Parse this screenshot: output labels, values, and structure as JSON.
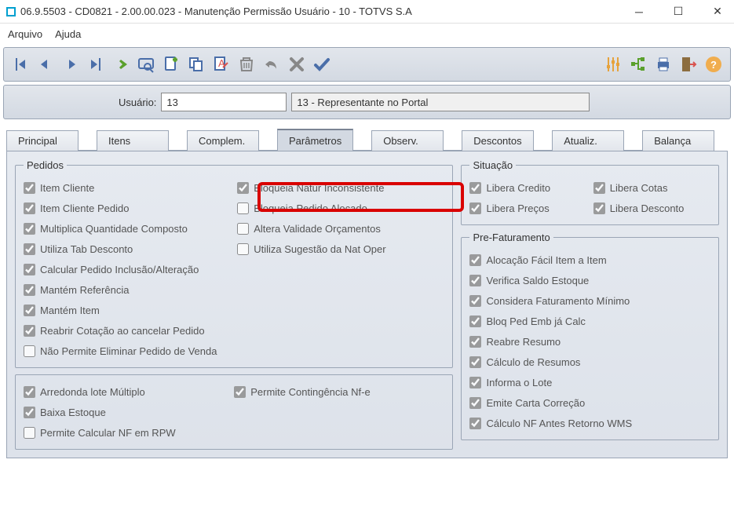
{
  "window": {
    "title": "06.9.5503 - CD0821 - 2.00.00.023 - Manutenção Permissão Usuário - 10 - TOTVS S.A"
  },
  "menu": {
    "arquivo": "Arquivo",
    "ajuda": "Ajuda"
  },
  "header": {
    "usuario_label": "Usuário:",
    "usuario_code": "13",
    "usuario_desc": "13 - Representante no Portal"
  },
  "tabs": {
    "principal": "Principal",
    "itens": "Itens",
    "complem": "Complem.",
    "parametros": "Parâmetros",
    "observ": "Observ.",
    "descontos": "Descontos",
    "atualiz": "Atualiz.",
    "balanca": "Balança"
  },
  "groups": {
    "pedidos": "Pedidos",
    "situacao": "Situação",
    "prefat": "Pre-Faturamento"
  },
  "pedidos": {
    "col1": [
      {
        "label": "Item Cliente",
        "checked": true
      },
      {
        "label": "Item Cliente Pedido",
        "checked": true
      },
      {
        "label": "Multiplica Quantidade Composto",
        "checked": true
      },
      {
        "label": "Utiliza Tab Desconto",
        "checked": true
      },
      {
        "label": "Calcular Pedido Inclusão/Alteração",
        "checked": true
      },
      {
        "label": "Mantém Referência",
        "checked": true
      },
      {
        "label": "Mantém Item",
        "checked": true
      },
      {
        "label": "Reabrir Cotação ao cancelar Pedido",
        "checked": true
      },
      {
        "label": "Não Permite Eliminar Pedido de Venda",
        "checked": false
      }
    ],
    "col2": [
      {
        "label": "Bloqueia Natur Inconsistente",
        "checked": true
      },
      {
        "label": "Bloqueia Pedido Alocado",
        "checked": false
      },
      {
        "label": "Altera Validade Orçamentos",
        "checked": false
      },
      {
        "label": "Utiliza Sugestão da Nat Oper",
        "checked": false
      }
    ]
  },
  "pedidos_bottom": {
    "col1": [
      {
        "label": "Arredonda lote Múltiplo",
        "checked": true
      },
      {
        "label": "Baixa Estoque",
        "checked": true
      },
      {
        "label": "Permite Calcular NF em RPW",
        "checked": false
      }
    ],
    "col2": [
      {
        "label": "Permite Contingência Nf-e",
        "checked": true
      }
    ]
  },
  "situacao": [
    {
      "label": "Libera Credito",
      "checked": true
    },
    {
      "label": "Libera Cotas",
      "checked": true
    },
    {
      "label": "Libera Preços",
      "checked": true
    },
    {
      "label": "Libera Desconto",
      "checked": true
    }
  ],
  "prefat": [
    {
      "label": "Alocação Fácil Item a Item",
      "checked": true
    },
    {
      "label": "Verifica Saldo Estoque",
      "checked": true
    },
    {
      "label": "Considera Faturamento Mínimo",
      "checked": true
    },
    {
      "label": "Bloq Ped Emb já Calc",
      "checked": true
    },
    {
      "label": "Reabre Resumo",
      "checked": true
    },
    {
      "label": "Cálculo de Resumos",
      "checked": true
    },
    {
      "label": "Informa o Lote",
      "checked": true
    },
    {
      "label": "Emite Carta Correção",
      "checked": true
    },
    {
      "label": "Cálculo NF Antes Retorno WMS",
      "checked": true
    }
  ]
}
